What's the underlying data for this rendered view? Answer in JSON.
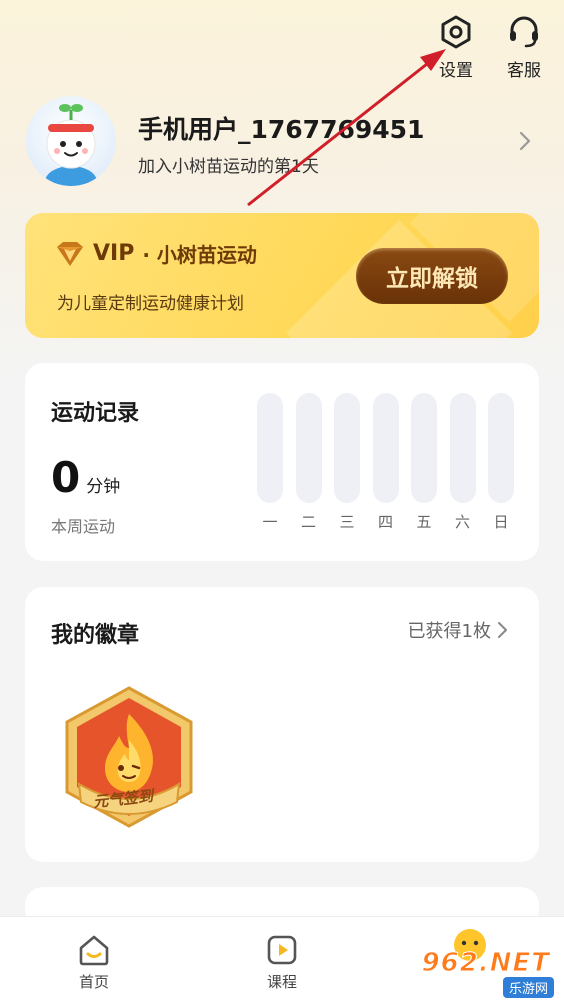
{
  "header": {
    "settings_label": "设置",
    "service_label": "客服"
  },
  "profile": {
    "username": "手机用户_1767769451",
    "joined_text": "加入小树苗运动的第1天"
  },
  "vip": {
    "badge_text": "VIP",
    "title": "· 小树苗运动",
    "subtitle": "为儿童定制运动健康计划",
    "unlock_button": "立即解锁"
  },
  "exercise": {
    "title": "运动记录",
    "minutes": "0",
    "minutes_unit": "分钟",
    "week_label": "本周运动",
    "days": [
      "一",
      "二",
      "三",
      "四",
      "五",
      "六",
      "日"
    ],
    "day_progress": [
      0,
      0,
      0,
      0,
      0,
      0,
      0
    ]
  },
  "badges": {
    "title": "我的徽章",
    "count_text": "已获得1枚",
    "items": [
      {
        "label": "元气签到"
      }
    ]
  },
  "tabbar": {
    "home": "首页",
    "course": "课程"
  },
  "watermark": {
    "top": "962.NET",
    "bottom": "乐游网"
  },
  "colors": {
    "accent": "#ffd04a",
    "vip_button": "#7a3e0c",
    "annotation": "#d01f2a"
  }
}
